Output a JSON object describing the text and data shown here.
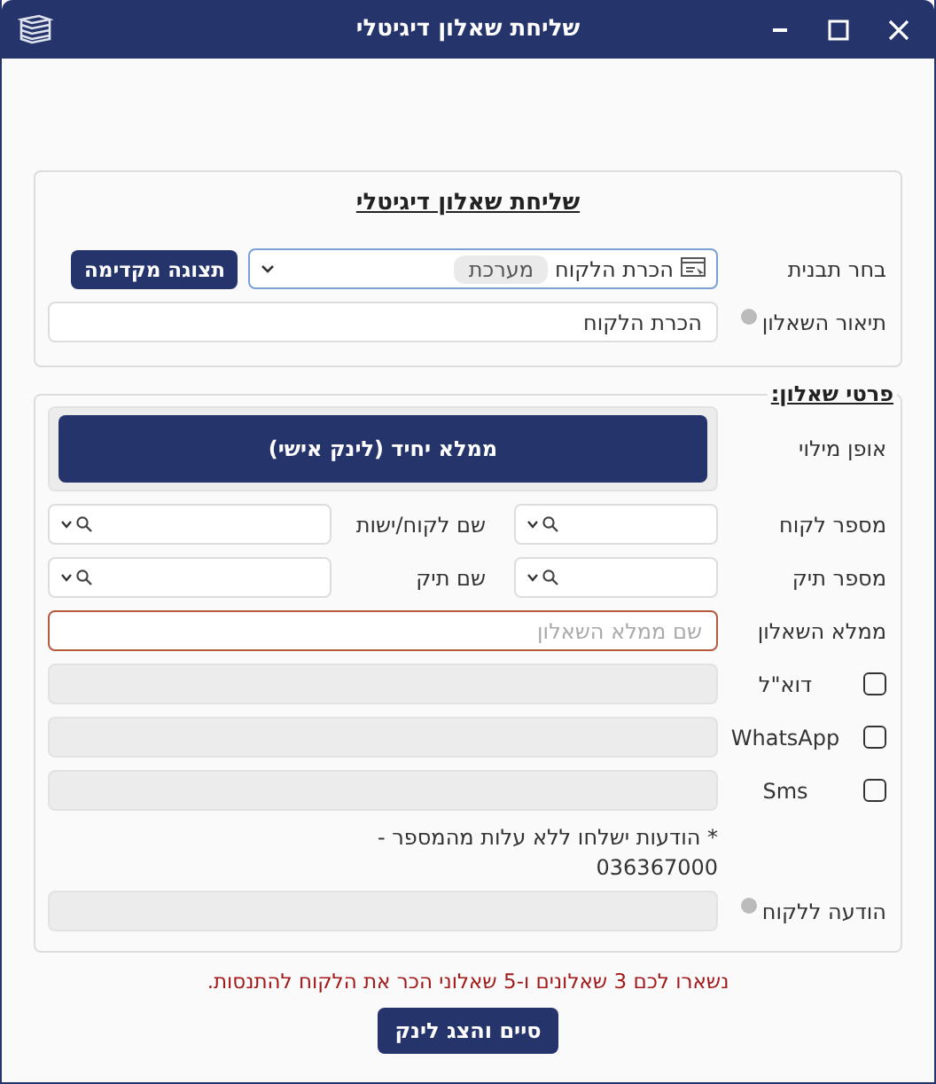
{
  "window": {
    "title": "שליחת שאלון דיגיטלי"
  },
  "form": {
    "heading": "שליחת שאלון דיגיטלי",
    "template": {
      "label": "בחר תבנית",
      "tag": "מערכת",
      "value": "הכרת הלקוח",
      "button": "תצוגה מקדימה"
    },
    "description": {
      "label": "תיאור השאלון",
      "value": "הכרת הלקוח"
    }
  },
  "details": {
    "legend": "פרטי שאלון:",
    "mode": {
      "label": "אופן מילוי",
      "button": "ממלא יחיד (לינק אישי)"
    },
    "lookups": [
      {
        "label": "מספר לקוח",
        "second_label": "שם לקוח/ישות"
      },
      {
        "label": "מספר תיק",
        "second_label": "שם תיק"
      }
    ],
    "filler": {
      "label": "ממלא השאלון",
      "placeholder": "שם ממלא השאלון",
      "invalid": true
    },
    "channels": [
      {
        "label": "דוא\"ל",
        "checked": false
      },
      {
        "label": "WhatsApp",
        "checked": false
      },
      {
        "label": "Sms",
        "checked": false
      }
    ],
    "note": "* הודעות ישלחו ללא עלות מהמספר - 036367000",
    "message": {
      "label": "הודעה ללקוח"
    }
  },
  "quota": "נשארו לכם 3 שאלונים ו-5 שאלוני הכר את הלקוח להתנסות.",
  "submit": "סיים והצג לינק"
}
